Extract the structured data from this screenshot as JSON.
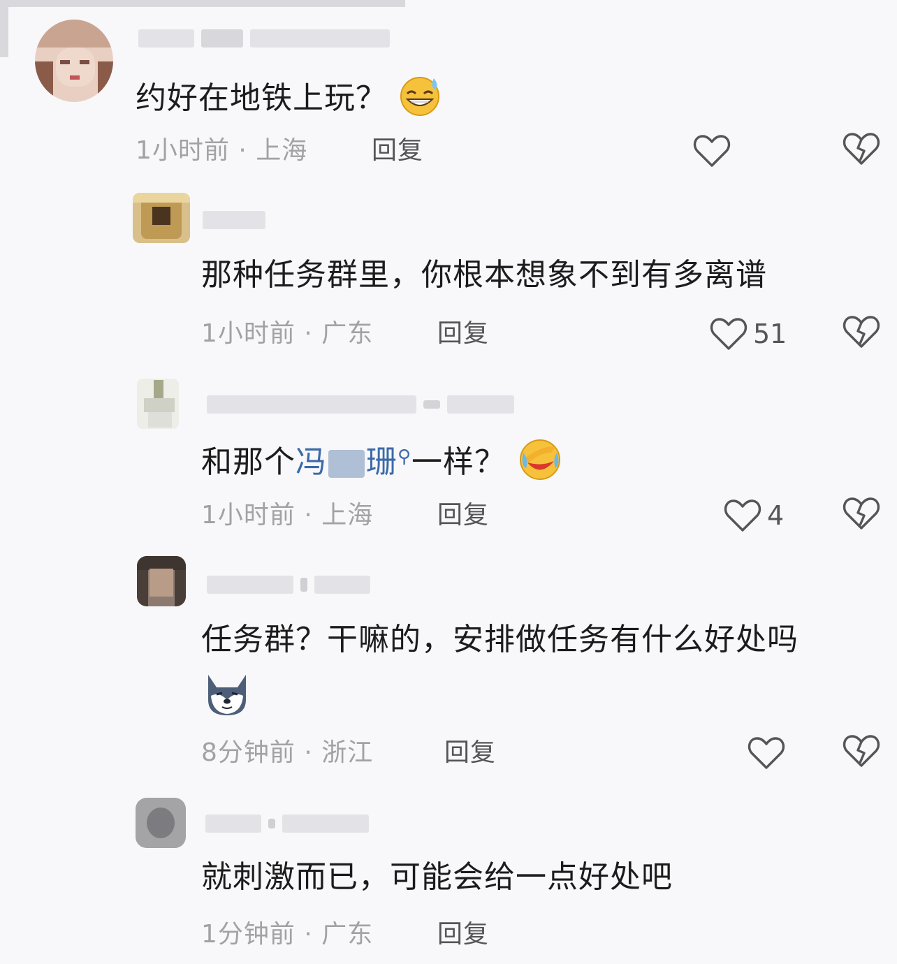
{
  "comments": [
    {
      "id": "c1",
      "text": "约好在地铁上玩？",
      "emoji": "grinning-sweat-emoji",
      "time": "1小时前 · 上海",
      "reply_label": "回复",
      "likes": ""
    },
    {
      "id": "c2",
      "text": "那种任务群里，你根本想象不到有多离谱",
      "time": "1小时前 · 广东",
      "reply_label": "回复",
      "likes": "51"
    },
    {
      "id": "c3",
      "text_before": "和那个",
      "link_start": "冯",
      "link_end": "珊",
      "text_after": "一样？",
      "emoji": "laughing-crying-emoji",
      "time": "1小时前 · 上海",
      "reply_label": "回复",
      "likes": "4"
    },
    {
      "id": "c4",
      "text": "任务群？干嘛的，安排做任务有什么好处吗",
      "emoji": "husky-dog-emoji",
      "time": "8分钟前 · 浙江",
      "reply_label": "回复",
      "likes": ""
    },
    {
      "id": "c5",
      "text": "就刺激而已，可能会给一点好处吧",
      "time": "1分钟前 · 广东",
      "reply_label": "回复",
      "likes": ""
    }
  ],
  "icons": {
    "like": "heart-outline-icon",
    "dislike": "broken-heart-icon",
    "search": "search-icon"
  },
  "colors": {
    "background": "#f8f8fa",
    "text": "#1c1c1c",
    "meta": "#a2a2a6",
    "link": "#3b6aa8"
  }
}
